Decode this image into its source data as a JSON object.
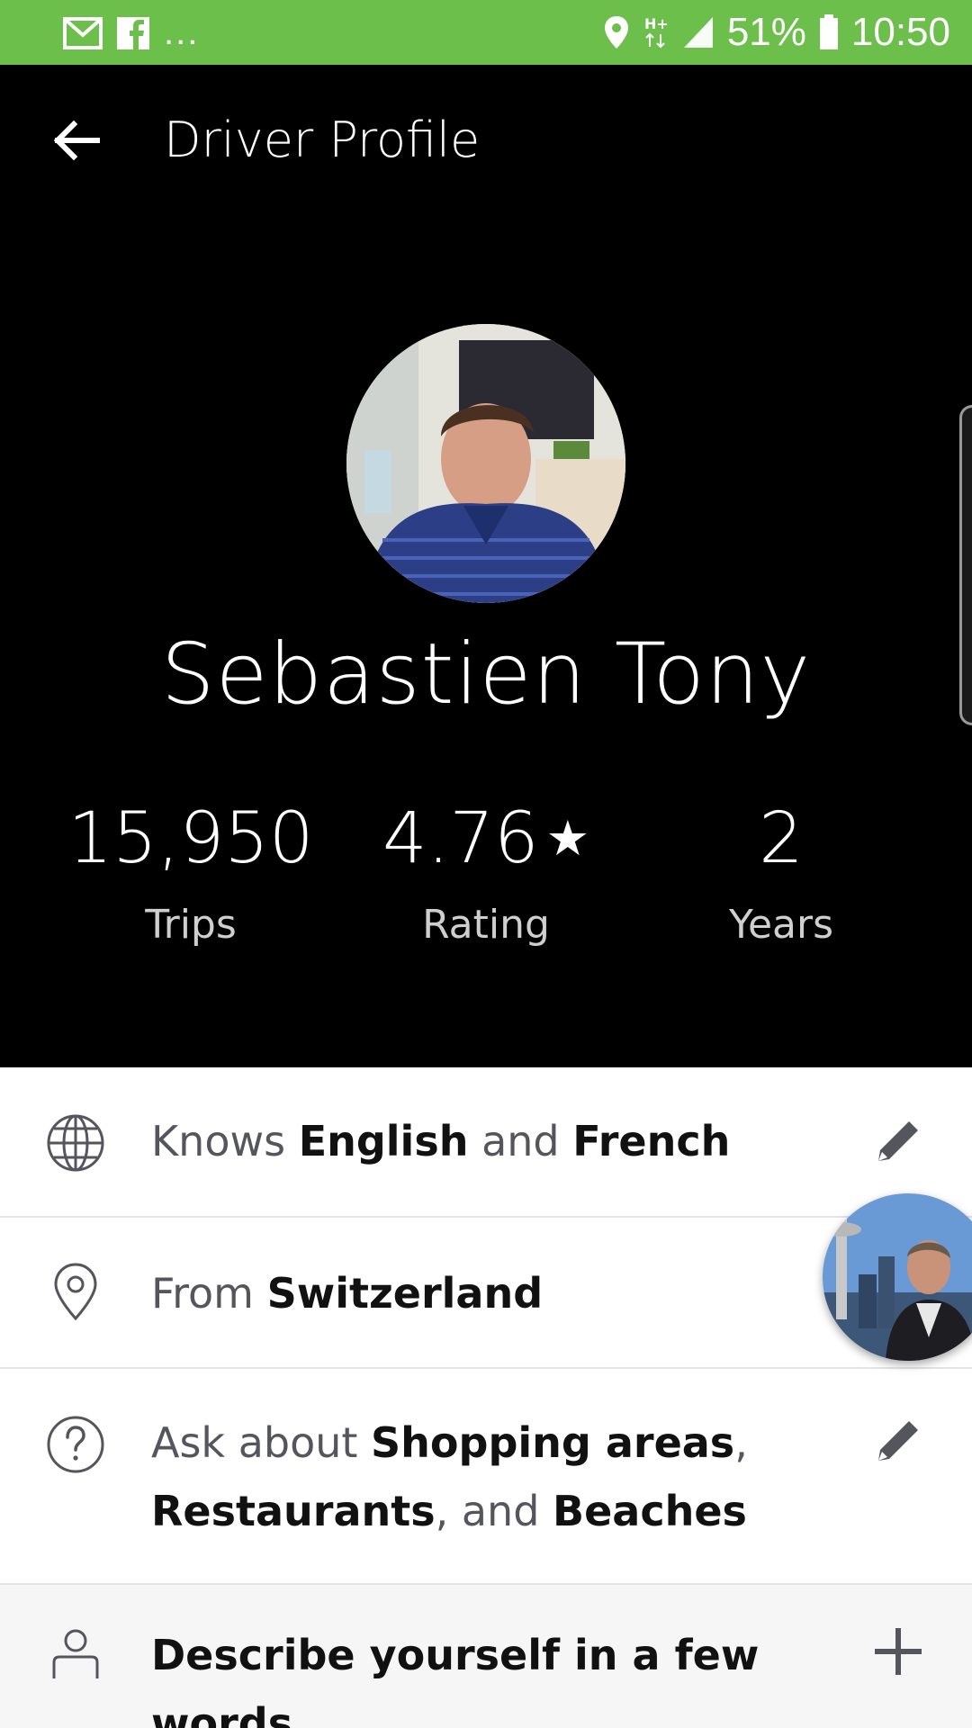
{
  "status_bar": {
    "left_icons": [
      "gmail-icon",
      "facebook-icon"
    ],
    "overflow": "...",
    "right_icons": [
      "location-icon",
      "network-hplus-icon",
      "signal-icon"
    ],
    "battery_percent": "51%",
    "time": "10:50"
  },
  "header": {
    "back_icon": "arrow-left-icon",
    "title": "Driver Profile"
  },
  "profile": {
    "name": "Sebastien Tony",
    "stats": [
      {
        "value": "15,950",
        "label": "Trips"
      },
      {
        "value": "4.76",
        "suffix": "★",
        "label": "Rating"
      },
      {
        "value": "2",
        "label": "Years"
      }
    ]
  },
  "details": {
    "languages": {
      "prefix": "Knows ",
      "lang1": "English",
      "joiner": " and ",
      "lang2": "French",
      "icon": "globe-icon"
    },
    "from": {
      "prefix": "From ",
      "place": "Switzerland",
      "icon": "location-pin-icon"
    },
    "ask_about": {
      "prefix": "Ask about ",
      "topic1": "Shopping areas",
      "sep1": ",",
      "topic2": "Restaurants",
      "sep2": ", and ",
      "topic3": "Beaches",
      "icon": "question-circle-icon"
    },
    "describe": {
      "text": "Describe yourself in a few words",
      "icon": "person-icon",
      "action_icon": "plus-icon"
    }
  },
  "colors": {
    "status_bar": "#6cbf4a",
    "header_bg": "#000000",
    "list_bg": "#ffffff",
    "accent_text": "#111111",
    "muted_text": "#55555d"
  }
}
